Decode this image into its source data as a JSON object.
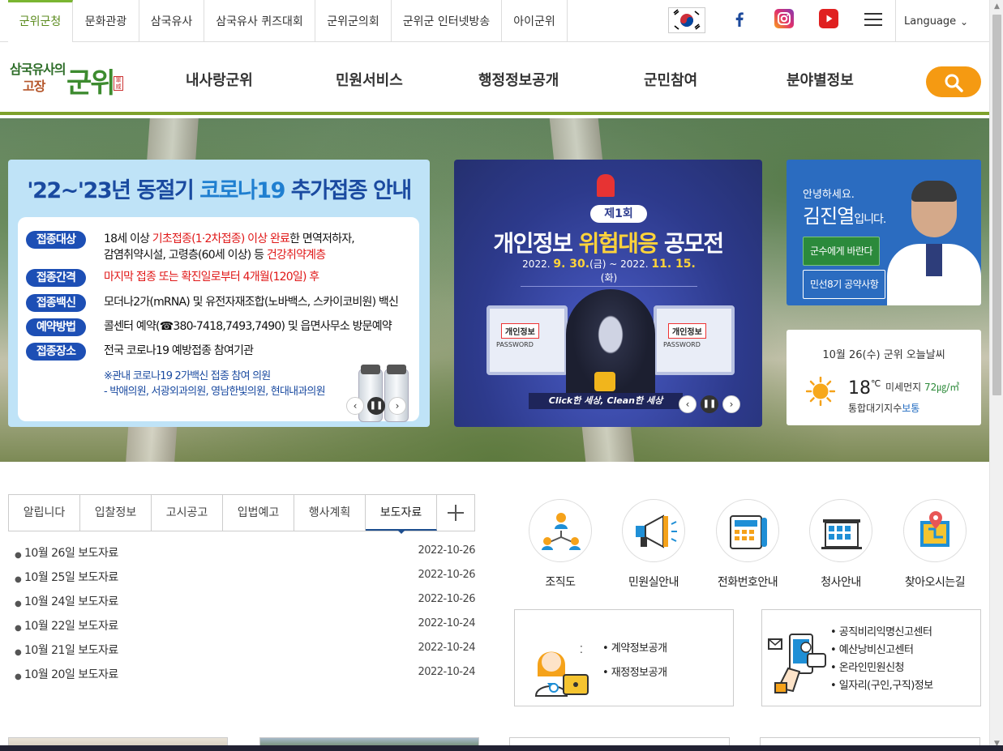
{
  "top_tabs": [
    "군위군청",
    "문화관광",
    "삼국유사",
    "삼국유사 퀴즈대회",
    "군위군의회",
    "군위군 인터넷방송",
    "아이군위"
  ],
  "language": "Language",
  "logo": {
    "line1": "삼국유사의",
    "line2": "고장",
    "main": "군위",
    "seal": "軍威"
  },
  "gnb": [
    "내사랑군위",
    "민원서비스",
    "행정정보공개",
    "군민참여",
    "분야별정보"
  ],
  "covid": {
    "title_pre": "'22~'23년 동절기 ",
    "title_hl": "코로나19",
    "title_post": " 추가접종 안내",
    "rows": [
      {
        "tag": "접종대상",
        "pre": "18세 이상 ",
        "red": "기초접종(1·2차접종) 이상 완료",
        "post": "한 면역저하자,"
      },
      {
        "tag": "접종간격",
        "red": "마지막 접종 또는 확진일로부터 4개월(120일) 후"
      },
      {
        "tag": "접종백신",
        "text": "모더나2가(mRNA) 및 유전자재조합(노바백스, 스카이코비원) 백신"
      },
      {
        "tag": "예약방법",
        "text": "콜센터 예약(☎380-7418,7493,7490) 및 읍면사무소 방문예약"
      },
      {
        "tag": "접종장소",
        "text": "전국 코로나19 예방접종 참여기관"
      }
    ],
    "row1_line2_pre": "감염취약시설, 고령층(60세 이상) 등 ",
    "row1_line2_red": "건강취약계층",
    "note1": "※관내 코로나19 2가백신 접종 참여 의원",
    "note2": " - 박애의원, 서광외과의원, 영남한빛의원, 현대내과의원"
  },
  "privacy": {
    "badge": "제1회",
    "headline_pre": "개인정보 ",
    "headline_hl": "위험대응",
    "headline_post": " 공모전",
    "date": {
      "y1": "2022. ",
      "d1": "9. 30.",
      "w1": "(금) ~ 2022. ",
      "d2": "11. 15.",
      "w2": "(화)"
    },
    "screen_label": "개인정보",
    "screen_sub": "PASSWORD",
    "slogan": "Click한 세상, Clean한 세상"
  },
  "mayor": {
    "greeting": "안녕하세요.",
    "name": "김진열",
    "name_suffix": "입니다.",
    "btn1": "군수에게 바란다",
    "btn2": "민선8기 공약사항"
  },
  "weather": {
    "date": "10월 26(수) 군위 오늘날씨",
    "temp": "18",
    "unit": "℃",
    "dust_label": "미세먼지 ",
    "dust_value": "72㎍/㎥",
    "air_label": "통합대기지수",
    "air_value": "보통"
  },
  "notice_tabs": [
    "알립니다",
    "입찰정보",
    "고시공고",
    "입법예고",
    "행사계획",
    "보도자료"
  ],
  "notices": [
    {
      "title": "10월 26일 보도자료",
      "date": "2022-10-26"
    },
    {
      "title": "10월 25일 보도자료",
      "date": "2022-10-26"
    },
    {
      "title": "10월 24일 보도자료",
      "date": "2022-10-26"
    },
    {
      "title": "10월 22일 보도자료",
      "date": "2022-10-24"
    },
    {
      "title": "10월 21일 보도자료",
      "date": "2022-10-24"
    },
    {
      "title": "10월 20일 보도자료",
      "date": "2022-10-24"
    }
  ],
  "quick": [
    "조직도",
    "민원실안내",
    "전화번호안내",
    "청사안내",
    "찾아오시는길"
  ],
  "box1": [
    "• 계약정보공개",
    "• 재정정보공개"
  ],
  "box2": [
    "• 공직비리익명신고센터",
    "• 예산낭비신고센터",
    "• 온라인민원신청",
    "• 일자리(구인,구직)정보"
  ],
  "colors": {
    "accent_green": "#7ea12b",
    "search_orange": "#f59a12",
    "covid_blue": "#1d4fb5",
    "mayor_blue": "#2b6cc0"
  }
}
